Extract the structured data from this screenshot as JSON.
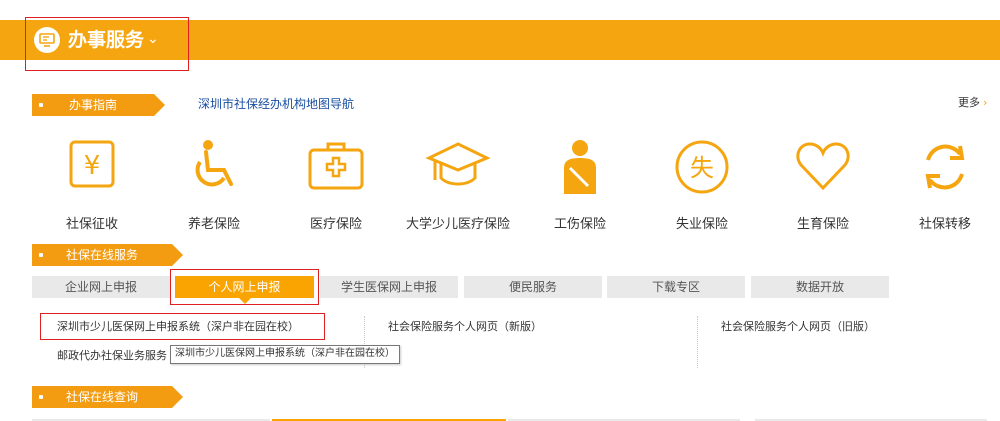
{
  "header": {
    "title": "办事服务",
    "icon": "monitor-icon",
    "accent": "#f5a50f"
  },
  "guide": {
    "label": "办事指南",
    "link": "深圳市社保经办机构地图导航",
    "more": "更多"
  },
  "services": [
    {
      "label": "社保征收",
      "icon": "yen-icon"
    },
    {
      "label": "养老保险",
      "icon": "wheelchair-icon"
    },
    {
      "label": "医疗保险",
      "icon": "medical-kit-icon"
    },
    {
      "label": "大学少儿医疗保险",
      "icon": "graduation-cap-icon"
    },
    {
      "label": "工伤保险",
      "icon": "injured-person-icon"
    },
    {
      "label": "失业保险",
      "icon": "unemployment-icon"
    },
    {
      "label": "生育保险",
      "icon": "heart-icon"
    },
    {
      "label": "社保转移",
      "icon": "refresh-icon"
    }
  ],
  "online": {
    "label": "社保在线服务",
    "tabs": [
      "企业网上申报",
      "个人网上申报",
      "学生医保网上申报",
      "便民服务",
      "下载专区",
      "数据开放"
    ],
    "active_tab": "个人网上申报",
    "links": [
      "深圳市少儿医保网上申报系统（深户非在园在校）",
      "社会保险服务个人网页（新版）",
      "社会保险服务个人网页（旧版）",
      "邮政代办社保业务服务"
    ],
    "tooltip": "深圳市少儿医保网上申报系统（深户非在园在校）"
  },
  "query": {
    "label": "社保在线查询"
  }
}
